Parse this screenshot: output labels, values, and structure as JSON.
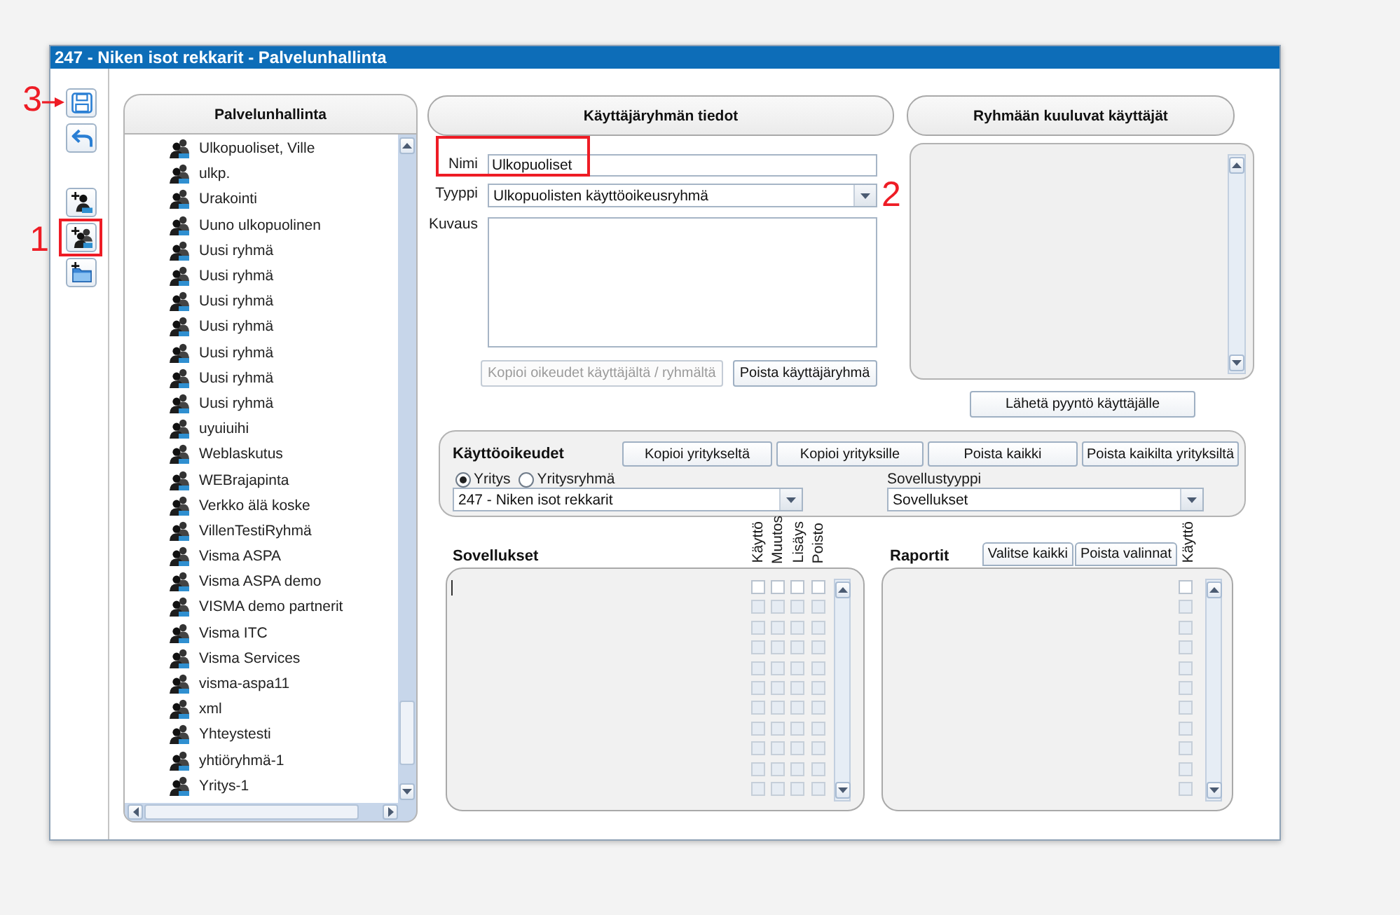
{
  "window": {
    "title": "247 - Niken isot rekkarit - Palvelunhallinta"
  },
  "toolbar": {
    "groups": [
      [
        {
          "kind": "save",
          "highlighted": false,
          "callout": {
            "text": "3",
            "arrow": true
          }
        },
        {
          "kind": "undo",
          "highlighted": false
        }
      ],
      [
        {
          "kind": "add-user",
          "highlighted": false
        },
        {
          "kind": "add-group",
          "highlighted": true,
          "callout": {
            "text": "1",
            "arrow": false
          }
        },
        {
          "kind": "add-folder",
          "highlighted": false
        }
      ]
    ]
  },
  "tree": {
    "title": "Palvelunhallinta",
    "items": [
      {
        "label": "Ulkopuoliset, Ville"
      },
      {
        "label": "ulkp."
      },
      {
        "label": "Urakointi"
      },
      {
        "label": "Uuno ulkopuolinen"
      },
      {
        "label": "Uusi ryhmä"
      },
      {
        "label": "Uusi ryhmä"
      },
      {
        "label": "Uusi ryhmä"
      },
      {
        "label": "Uusi ryhmä"
      },
      {
        "label": "Uusi ryhmä"
      },
      {
        "label": "Uusi ryhmä"
      },
      {
        "label": "Uusi ryhmä"
      },
      {
        "label": "uyuiuihi"
      },
      {
        "label": "Weblaskutus"
      },
      {
        "label": "WEBrajapinta"
      },
      {
        "label": "Verkko älä koske"
      },
      {
        "label": "VillenTestiRyhmä"
      },
      {
        "label": "Visma ASPA"
      },
      {
        "label": "Visma ASPA demo"
      },
      {
        "label": "VISMA demo partnerit"
      },
      {
        "label": "Visma ITC"
      },
      {
        "label": "Visma Services"
      },
      {
        "label": "visma-aspa11"
      },
      {
        "label": "xml"
      },
      {
        "label": "Yhteystesti"
      },
      {
        "label": "yhtiöryhmä-1"
      },
      {
        "label": "Yritys-1"
      }
    ]
  },
  "group_info": {
    "title": "Käyttäjäryhmän tiedot",
    "fields": [
      {
        "kind": "text",
        "label": "Nimi",
        "value": "Ulkopuoliset",
        "highlighted": true
      },
      {
        "kind": "select",
        "label": "Tyyppi",
        "value": "Ulkopuolisten käyttöoikeusryhmä",
        "highlighted": false,
        "callout": {
          "text": "2",
          "arrow": false
        }
      },
      {
        "kind": "textarea",
        "label": "Kuvaus",
        "highlighted": false
      }
    ],
    "buttons": [
      {
        "label": "Kopioi oikeudet käyttäjältä / ryhmältä",
        "disabled": true
      },
      {
        "label": "Poista käyttäjäryhmä",
        "disabled": false
      }
    ]
  },
  "members": {
    "title": "Ryhmään kuuluvat käyttäjät",
    "button": "Lähetä pyyntö käyttäjälle"
  },
  "permissions": {
    "title": "Käyttöoikeudet",
    "buttons": [
      "Kopioi yritykseltä",
      "Kopioi yrityksille",
      "Poista kaikki",
      "Poista kaikilta yrityksiltä"
    ],
    "scope_options": [
      {
        "label": "Yritys",
        "selected": true
      },
      {
        "label": "Yritysryhmä",
        "selected": false
      }
    ],
    "company": "247 - Niken isot rekkarit",
    "app_type": {
      "label": "Sovellustyyppi",
      "value": "Sovellukset"
    }
  },
  "applications": {
    "title": "Sovellukset",
    "columns": [
      "Käyttö",
      "Muutos",
      "Lisäys",
      "Poisto"
    ],
    "rows": [
      {
        "disabled": false,
        "checked": [
          false,
          false,
          false,
          false
        ]
      },
      {
        "disabled": true,
        "checked": [
          false,
          false,
          false,
          false
        ]
      },
      {
        "disabled": true,
        "checked": [
          false,
          false,
          false,
          false
        ]
      },
      {
        "disabled": true,
        "checked": [
          false,
          false,
          false,
          false
        ]
      },
      {
        "disabled": true,
        "checked": [
          false,
          false,
          false,
          false
        ]
      },
      {
        "disabled": true,
        "checked": [
          false,
          false,
          false,
          false
        ]
      },
      {
        "disabled": true,
        "checked": [
          false,
          false,
          false,
          false
        ]
      },
      {
        "disabled": true,
        "checked": [
          false,
          false,
          false,
          false
        ]
      },
      {
        "disabled": true,
        "checked": [
          false,
          false,
          false,
          false
        ]
      },
      {
        "disabled": true,
        "checked": [
          false,
          false,
          false,
          false
        ]
      },
      {
        "disabled": true,
        "checked": [
          false,
          false,
          false,
          false
        ]
      }
    ]
  },
  "reports": {
    "title": "Raportit",
    "buttons": [
      "Valitse kaikki",
      "Poista valinnat"
    ],
    "columns": [
      "Käyttö"
    ],
    "rows": [
      {
        "disabled": false,
        "checked": [
          false
        ]
      },
      {
        "disabled": true,
        "checked": [
          false
        ]
      },
      {
        "disabled": true,
        "checked": [
          false
        ]
      },
      {
        "disabled": true,
        "checked": [
          false
        ]
      },
      {
        "disabled": true,
        "checked": [
          false
        ]
      },
      {
        "disabled": true,
        "checked": [
          false
        ]
      },
      {
        "disabled": true,
        "checked": [
          false
        ]
      },
      {
        "disabled": true,
        "checked": [
          false
        ]
      },
      {
        "disabled": true,
        "checked": [
          false
        ]
      },
      {
        "disabled": true,
        "checked": [
          false
        ]
      },
      {
        "disabled": true,
        "checked": [
          false
        ]
      }
    ]
  }
}
